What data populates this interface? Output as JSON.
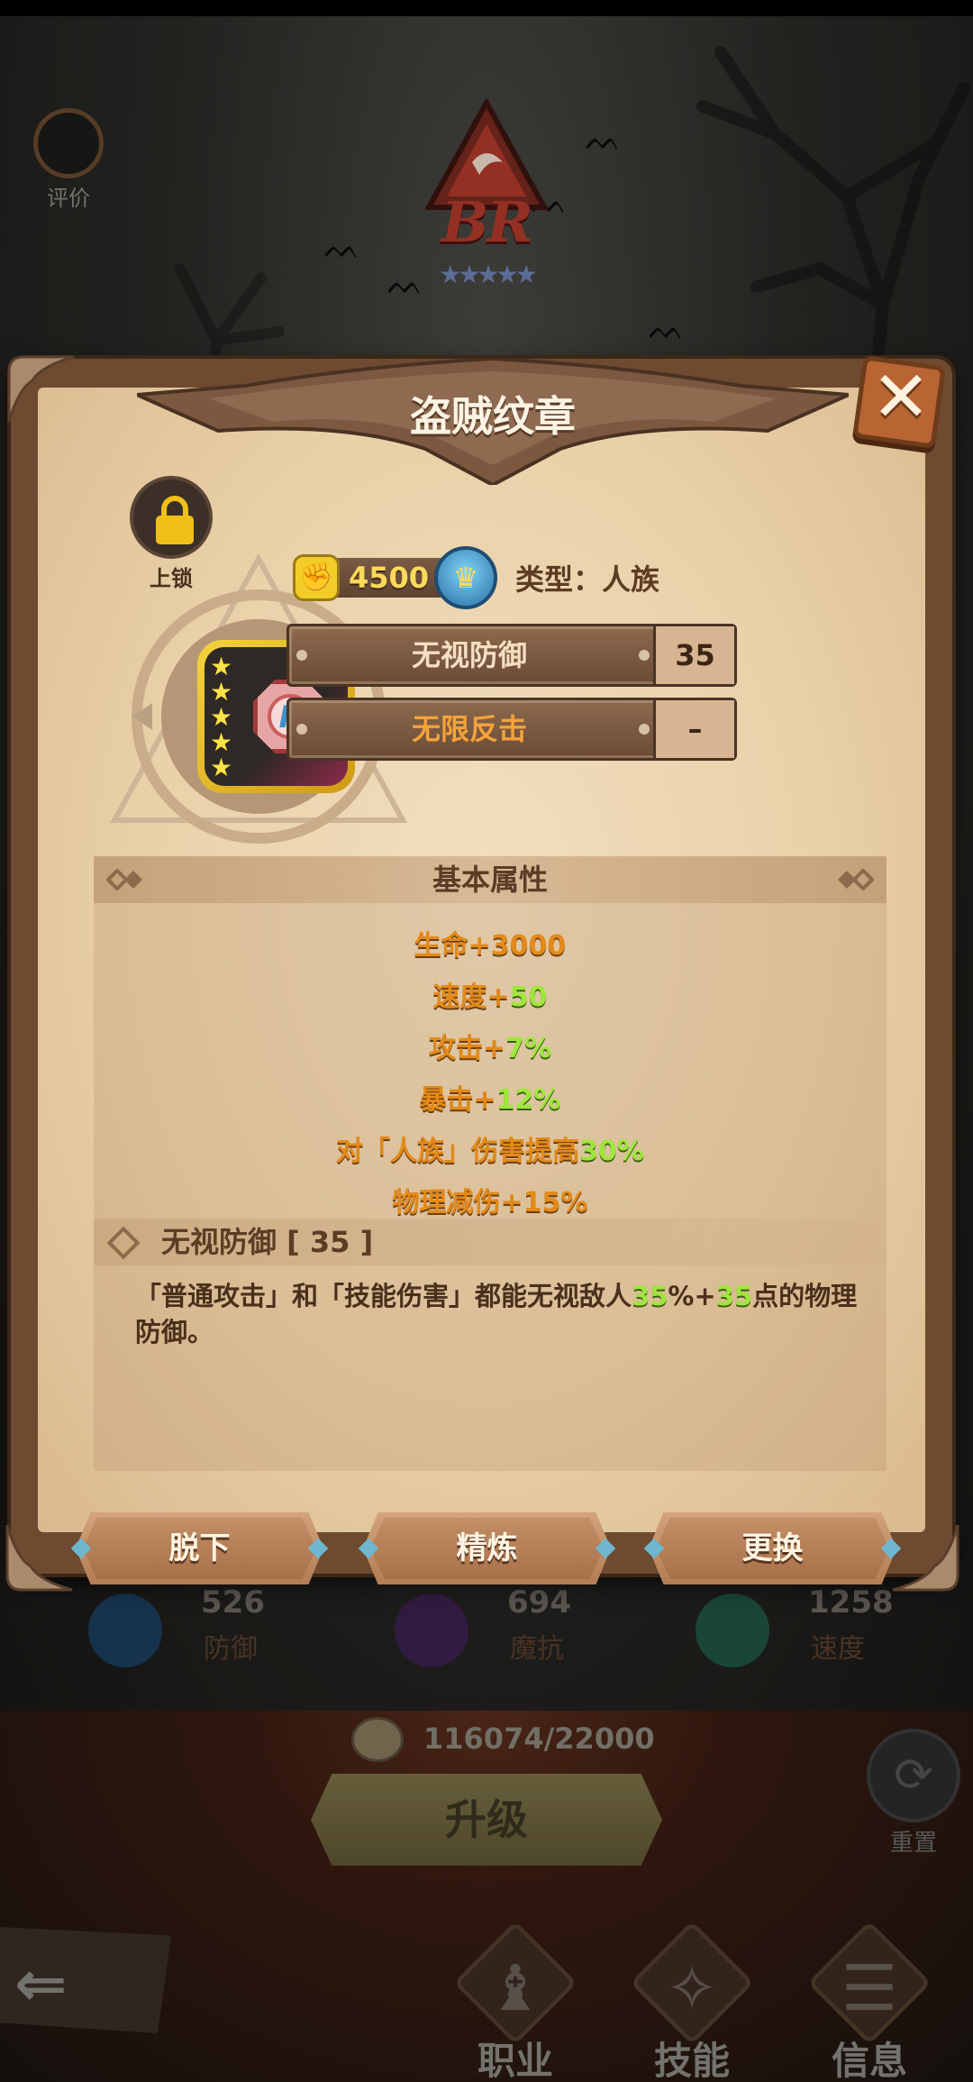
{
  "top": {
    "rate_label": "评价",
    "rank_label": "BR",
    "rank_stars": "★★★★★"
  },
  "dialog": {
    "title": "盗贼纹章",
    "lock_label": "上锁",
    "power_value": "4500",
    "type_text": "类型：人族",
    "emblem_star_count": 5,
    "skills": [
      {
        "name": "无视防御",
        "level": "35",
        "name_color": "#f5dfc0"
      },
      {
        "name": "无限反击",
        "level": "–",
        "name_color": "#f4a23a"
      }
    ],
    "basic_title": "基本属性",
    "attributes": [
      {
        "label": "生命+",
        "value": "3000",
        "value_color": "orange"
      },
      {
        "label": "速度+",
        "value": "50",
        "value_color": "green"
      },
      {
        "label": "攻击+",
        "value": "7%",
        "value_color": "green"
      },
      {
        "label": "暴击+",
        "value": "12%",
        "value_color": "green"
      },
      {
        "label": "对「人族」伤害提高",
        "value": "30%",
        "value_color": "green"
      },
      {
        "label": "物理减伤+",
        "value": "15%",
        "value_color": "orange"
      }
    ],
    "passive_title": "无视防御 [ 35 ]",
    "passive_desc_parts": {
      "before": "「普通攻击」和「技能伤害」都能无视敌人",
      "v1": "35",
      "mid": "%+",
      "v2": "35",
      "after": "点的物理防御。"
    },
    "buttons": {
      "remove": "脱下",
      "refine": "精炼",
      "replace": "更换"
    }
  },
  "stats": [
    {
      "value": "526",
      "label": "防御",
      "icon": "shield-icon",
      "color": "#1c3f5e"
    },
    {
      "value": "694",
      "label": "魔抗",
      "icon": "lightning-icon",
      "color": "#3c2350"
    },
    {
      "value": "1258",
      "label": "速度",
      "icon": "speed-icon",
      "color": "#1f5645"
    }
  ],
  "upgrade": {
    "gold": "116074/22000",
    "label": "升级",
    "reset_label": "重置"
  },
  "nav": {
    "items": [
      {
        "label": "职业",
        "icon": "chess-icon",
        "glyph": "♝"
      },
      {
        "label": "技能",
        "icon": "skill-icon",
        "glyph": "✧"
      },
      {
        "label": "信息",
        "icon": "info-icon",
        "glyph": "☰"
      }
    ]
  },
  "colors": {
    "accent_orange": "#e38a19",
    "accent_green": "#9fe63c",
    "panel_brown": "#6d4a30",
    "paper": "#e9d0a8"
  }
}
